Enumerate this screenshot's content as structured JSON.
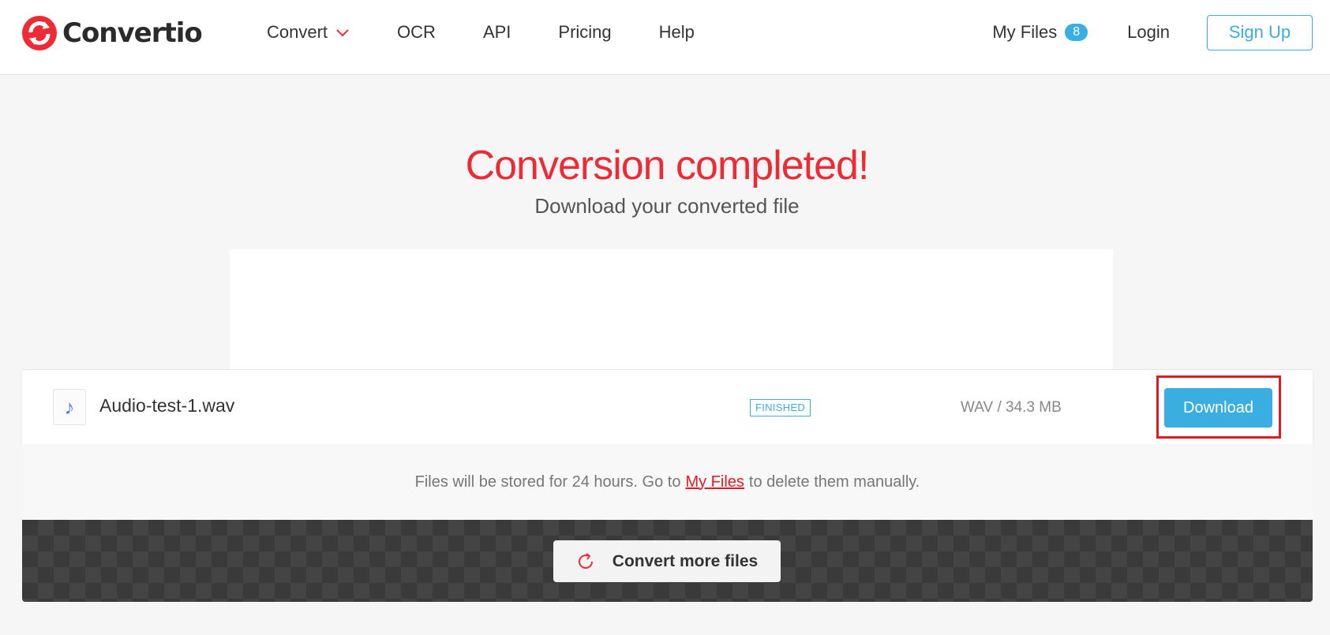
{
  "header": {
    "logo_text": "Convertio",
    "nav": [
      {
        "label": "Convert",
        "has_dropdown": true
      },
      {
        "label": "OCR"
      },
      {
        "label": "API"
      },
      {
        "label": "Pricing"
      },
      {
        "label": "Help"
      }
    ],
    "my_files_label": "My Files",
    "my_files_count": "8",
    "login_label": "Login",
    "signup_label": "Sign Up"
  },
  "hero": {
    "title": "Conversion completed!",
    "subtitle": "Download your converted file"
  },
  "file": {
    "icon": "music-note-icon",
    "name": "Audio-test-1.wav",
    "status": "FINISHED",
    "meta": "WAV / 34.3 MB",
    "download_label": "Download"
  },
  "notice": {
    "before": "Files will be stored for 24 hours. Go to",
    "link": "My Files",
    "after": "to delete them manually."
  },
  "actions": {
    "convert_more_label": "Convert more files"
  },
  "colors": {
    "brand_red": "#ee2b34",
    "accent_blue": "#3aaee0",
    "highlight_red": "#e11b22"
  }
}
